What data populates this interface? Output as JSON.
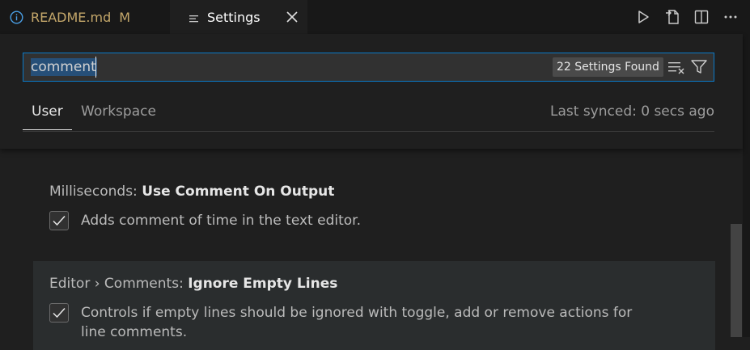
{
  "tabs": {
    "readme": {
      "label": "README.md",
      "modified": "M"
    },
    "settings": {
      "label": "Settings"
    }
  },
  "search": {
    "value": "comment",
    "results": "22 Settings Found"
  },
  "scope": {
    "user": "User",
    "workspace": "Workspace",
    "synced": "Last synced: 0 secs ago"
  },
  "settings": [
    {
      "category": "Milliseconds: ",
      "name": "Use Comment On Output",
      "checked": true,
      "description": "Adds comment of time in the text editor."
    },
    {
      "category": "Editor › Comments: ",
      "name": "Ignore Empty Lines",
      "checked": true,
      "description": "Controls if empty lines should be ignored with toggle, add or remove actions for line comments."
    }
  ],
  "icons": {
    "info": "info-icon",
    "settings_tab": "lines-icon",
    "close": "close-icon",
    "run": "play-icon",
    "open_file": "open-file-icon",
    "split": "split-editor-icon",
    "more": "more-icon",
    "clear": "clear-filter-icon",
    "filter": "filter-icon"
  },
  "colors": {
    "accent": "#0a7ac8",
    "modified": "#c4a76a"
  }
}
